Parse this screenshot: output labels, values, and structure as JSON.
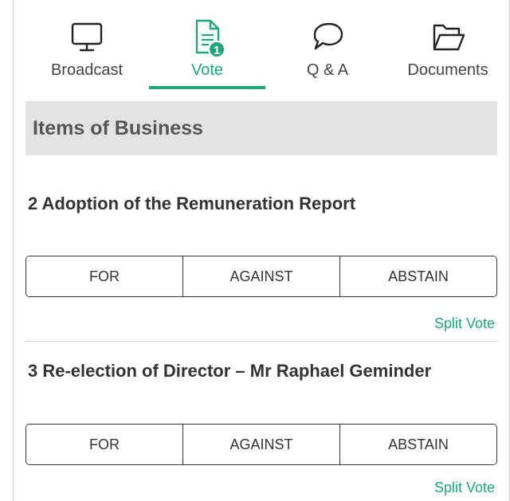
{
  "tabs": [
    {
      "label": "Broadcast",
      "icon": "monitor-icon",
      "active": false
    },
    {
      "label": "Vote",
      "icon": "document-icon",
      "active": true,
      "badge": "1"
    },
    {
      "label": "Q & A",
      "icon": "speech-bubble-icon",
      "active": false
    },
    {
      "label": "Documents",
      "icon": "folder-open-icon",
      "active": false
    }
  ],
  "section": {
    "title": "Items of Business"
  },
  "items": [
    {
      "title": "2 Adoption of the Remuneration Report",
      "options": [
        "FOR",
        "AGAINST",
        "ABSTAIN"
      ],
      "split_label": "Split Vote"
    },
    {
      "title": "3 Re-election of Director – Mr Raphael Geminder",
      "options": [
        "FOR",
        "AGAINST",
        "ABSTAIN"
      ],
      "split_label": "Split Vote"
    }
  ],
  "colors": {
    "accent": "#1fa67a",
    "header_bg": "#e3e3e3",
    "text": "#333333"
  }
}
